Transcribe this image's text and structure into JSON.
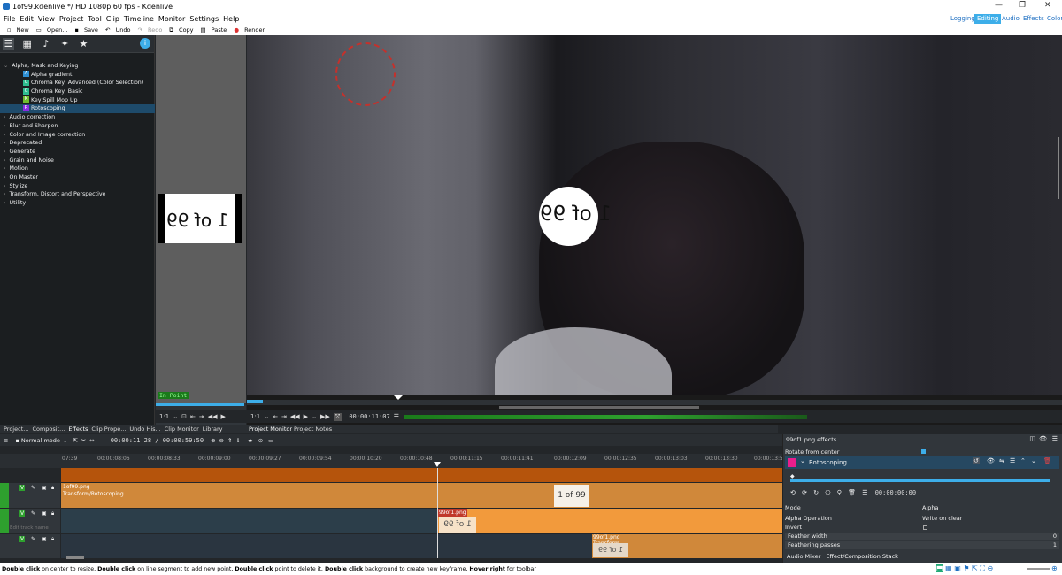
{
  "window": {
    "title": "1of99.kdenlive */ HD 1080p 60 fps - Kdenlive"
  },
  "menu": [
    "File",
    "Edit",
    "View",
    "Project",
    "Tool",
    "Clip",
    "Timeline",
    "Monitor",
    "Settings",
    "Help"
  ],
  "workspaces": [
    "Logging",
    "Editing",
    "Audio",
    "Effects",
    "Color"
  ],
  "toolbar": {
    "new": "New",
    "open": "Open...",
    "save": "Save",
    "undo": "Undo",
    "redo": "Redo",
    "copy": "Copy",
    "paste": "Paste",
    "render": "Render"
  },
  "effects_tree": {
    "category_open": "Alpha, Mask and Keying",
    "sub_items": [
      {
        "badge": "A",
        "label": "Alpha gradient",
        "color": "#2e8fd3"
      },
      {
        "badge": "C",
        "label": "Chroma Key: Advanced (Color Selection)",
        "color": "#2ebd8f"
      },
      {
        "badge": "C",
        "label": "Chroma Key: Basic",
        "color": "#2ebd8f"
      },
      {
        "badge": "K",
        "label": "Key Spill Mop Up",
        "color": "#6fbd2e"
      },
      {
        "badge": "R",
        "label": "Rotoscoping",
        "color": "#8a2be2"
      }
    ],
    "categories": [
      "Audio correction",
      "Blur and Sharpen",
      "Color and Image correction",
      "Deprecated",
      "Generate",
      "Grain and Noise",
      "Motion",
      "On Master",
      "Stylize",
      "Transform, Distort and Perspective",
      "Utility"
    ]
  },
  "clip_monitor": {
    "image_text": "1 of 99",
    "in_point": "In Point",
    "zoom": "1:1"
  },
  "project_monitor": {
    "zoom": "1:1",
    "timecode": "00:00:11:07",
    "circle_text": "1 of 99"
  },
  "tabs_left": [
    "Project...",
    "Composit...",
    "Effects",
    "Clip Prope...",
    "Undo His...",
    "Clip Monitor",
    "Library"
  ],
  "tabs_mid": [
    "Project Monitor",
    "Project Notes"
  ],
  "timeline": {
    "mode": "Normal mode",
    "position": "00:00:11:28 / 00:00:59:50",
    "ruler": [
      "07:39",
      "00:00:08:06",
      "00:00:08:33",
      "00:00:09:00",
      "00:00:09:27",
      "00:00:09:54",
      "00:00:10:20",
      "00:00:10:48",
      "00:00:11:15",
      "00:00:11:41",
      "00:00:12:09",
      "00:00:12:35",
      "00:00:13:03",
      "00:00:13:30",
      "00:00:13:5"
    ],
    "clips": {
      "v3_name": "1of99.png",
      "v3_effect": "Transform/Rotoscoping",
      "v3_thumb": "1 of 99",
      "v2_name": "99of1.png",
      "v2_thumb": "1 of 99",
      "v2_placeholder": "Edit track name",
      "v1_name": "99of1.png",
      "v1_effect": "Transform",
      "v1_thumb": "1 of 99"
    },
    "track_label": "V"
  },
  "effect_stack": {
    "title": "99of1.png effects",
    "effect_name": "Rotoscoping",
    "top_param": "Rotate from center",
    "keyframe_timecode": "00:00:00:00",
    "params": [
      {
        "name": "Mode",
        "value": "Alpha"
      },
      {
        "name": "Alpha Operation",
        "value": "Write on clear"
      },
      {
        "name": "Invert",
        "value": ""
      },
      {
        "name": "Feather width",
        "value": "0"
      },
      {
        "name": "Feathering passes",
        "value": "1"
      }
    ],
    "bottom_tabs": [
      "Audio Mixer",
      "Effect/Composition Stack"
    ]
  },
  "status": {
    "b1": "Double click",
    "t1": " on center to resize, ",
    "b2": "Double click",
    "t2": " on line segment to add new point, ",
    "b3": "Double click",
    "t3": " point to delete it, ",
    "b4": "Double click",
    "t4": " background to create new keyframe, ",
    "b5": "Hover right",
    "t5": " for toolbar"
  }
}
